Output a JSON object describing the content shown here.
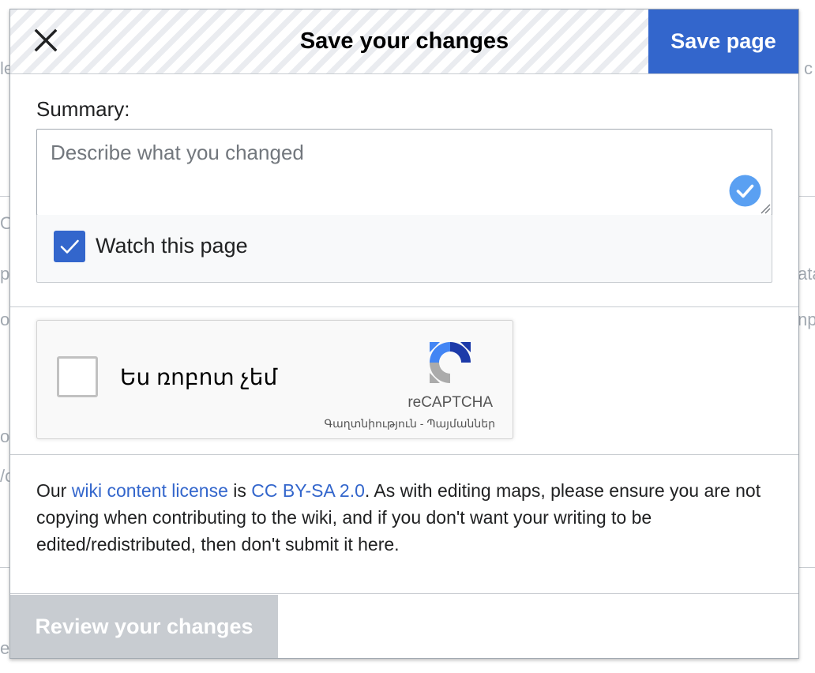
{
  "dialog": {
    "title": "Save your changes",
    "save_button": "Save page",
    "close_icon": "close-icon"
  },
  "summary": {
    "label": "Summary:",
    "placeholder": "Describe what you changed",
    "value": ""
  },
  "watch": {
    "checked": true,
    "label": "Watch this page"
  },
  "captcha": {
    "checked": false,
    "label": "Ես ռոբոտ չեմ",
    "brand": "reCAPTCHA",
    "privacy": "Գաղտնիություն",
    "separator": " - ",
    "terms": "Պայմաններ"
  },
  "license": {
    "before_link1": "Our ",
    "link1": "wiki content license",
    "between": " is ",
    "link2": "CC BY-SA 2.0",
    "after": ". As with editing maps, please ensure you are not copying when contributing to the wiki, and if you don't want your writing to be edited/redistributed, then don't submit it here."
  },
  "footer": {
    "review_button": "Review your changes",
    "review_enabled": false
  },
  "colors": {
    "primary": "#3366cc",
    "disabled": "#c8ccd1",
    "border": "#a2a9b1",
    "text": "#202122",
    "placeholder": "#72777d",
    "grammar_check": "#5aa0f2"
  }
}
